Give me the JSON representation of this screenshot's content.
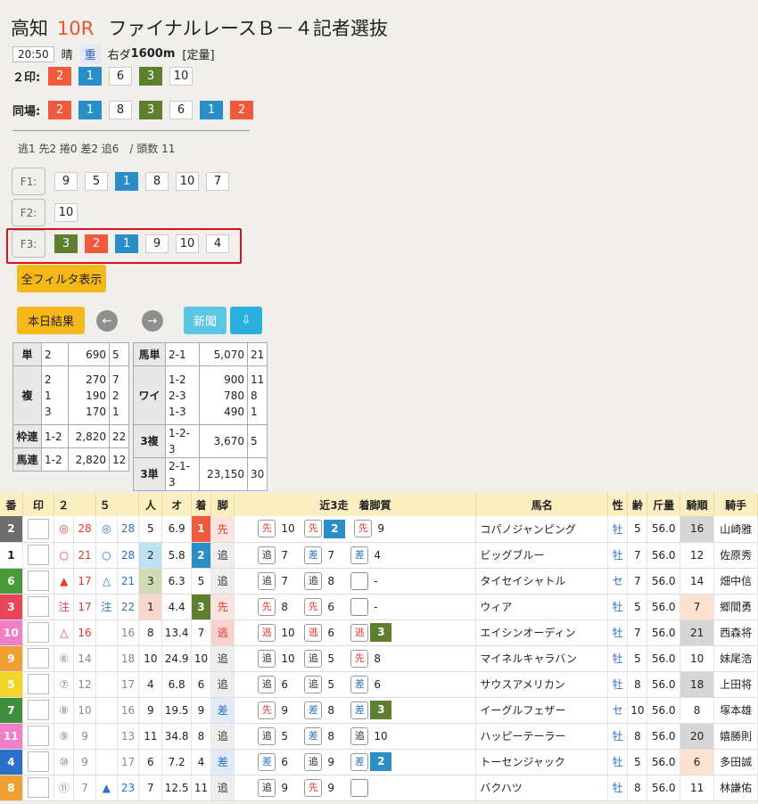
{
  "header": {
    "track": "高知",
    "race_no": "10R",
    "race_name": "ファイナルレースＢ－４記者選抜",
    "time": "20:50",
    "weather": "晴",
    "condition": "重",
    "course": "右ダ",
    "distance": "1600m",
    "rule": "[定量]"
  },
  "marks2": {
    "label": "２印:",
    "nums": [
      {
        "v": "2",
        "c": "c1"
      },
      {
        "v": "1",
        "c": "c2"
      },
      {
        "v": "6",
        "c": ""
      },
      {
        "v": "3",
        "c": "c3"
      },
      {
        "v": "10",
        "c": ""
      }
    ]
  },
  "same": {
    "label": "同場:",
    "nums": [
      {
        "v": "2",
        "c": "c1"
      },
      {
        "v": "1",
        "c": "c2"
      },
      {
        "v": "8",
        "c": ""
      },
      {
        "v": "3",
        "c": "c3"
      },
      {
        "v": "6",
        "c": ""
      },
      {
        "v": "1",
        "c": "c2"
      },
      {
        "v": "2",
        "c": "c1"
      }
    ]
  },
  "stats": "逃1 先2 捲0 差2 追6　/ 頭数 11",
  "filters": [
    {
      "label": "F1:",
      "nums": [
        {
          "v": "9",
          "c": ""
        },
        {
          "v": "5",
          "c": ""
        },
        {
          "v": "1",
          "c": "c2"
        },
        {
          "v": "8",
          "c": ""
        },
        {
          "v": "10",
          "c": ""
        },
        {
          "v": "7",
          "c": ""
        }
      ]
    },
    {
      "label": "F2:",
      "nums": [
        {
          "v": "10",
          "c": ""
        }
      ]
    },
    {
      "label": "F3:",
      "nums": [
        {
          "v": "3",
          "c": "c3"
        },
        {
          "v": "2",
          "c": "c1"
        },
        {
          "v": "1",
          "c": "c2"
        },
        {
          "v": "9",
          "c": ""
        },
        {
          "v": "10",
          "c": ""
        },
        {
          "v": "4",
          "c": ""
        }
      ]
    }
  ],
  "buttons": {
    "all_filters": "全フィルタ表示",
    "today_results": "本日結果",
    "prev": "←",
    "next": "→",
    "newspaper": "新聞",
    "download": "⇩"
  },
  "payout_left": {
    "tan": {
      "label": "単",
      "combo": "2",
      "amount": "690",
      "pop": "5"
    },
    "fuku": {
      "label": "複",
      "rows": [
        {
          "combo": "2",
          "amount": "270",
          "pop": "7"
        },
        {
          "combo": "1",
          "amount": "190",
          "pop": "2"
        },
        {
          "combo": "3",
          "amount": "170",
          "pop": "1"
        }
      ]
    },
    "wakuren": {
      "label": "枠連",
      "combo": "1-2",
      "amount": "2,820",
      "pop": "22"
    },
    "umaren": {
      "label": "馬連",
      "combo": "1-2",
      "amount": "2,820",
      "pop": "12"
    }
  },
  "payout_right": {
    "umatan": {
      "label": "馬単",
      "combo": "2-1",
      "amount": "5,070",
      "pop": "21"
    },
    "wide": {
      "label": "ワイ",
      "rows": [
        {
          "combo": "1-2",
          "amount": "900",
          "pop": "11"
        },
        {
          "combo": "2-3",
          "amount": "780",
          "pop": "8"
        },
        {
          "combo": "1-3",
          "amount": "490",
          "pop": "1"
        }
      ]
    },
    "sanfuku": {
      "label": "3複",
      "combo": "1-2-3",
      "amount": "3,670",
      "pop": "5"
    },
    "santan": {
      "label": "3単",
      "combo": "2-1-3",
      "amount": "23,150",
      "pop": "30"
    }
  },
  "table": {
    "headers": {
      "ban": "番",
      "in": "印",
      "two": "２",
      "five": "５",
      "pop": "人",
      "odds": "オ",
      "finish": "着",
      "leg": "脚",
      "recent": "近3走　着脚質",
      "name": "馬名",
      "sex": "性",
      "age": "齢",
      "weight": "斤量",
      "jrank": "騎順",
      "jockey": "騎手"
    },
    "rows": [
      {
        "ban": "2",
        "bc": "#6e6e6e",
        "m2": "◎",
        "m2c": "red",
        "v2": "28",
        "v2c": "red",
        "m5": "◎",
        "m5c": "blue",
        "v5": "28",
        "v5c": "blue",
        "pop": "5",
        "popbg": "",
        "odds": "6.9",
        "fin": "1",
        "finbg": "#ef5a3c",
        "leg": "先",
        "legbg": "#fbe3df",
        "legc": "#e03a2a",
        "r": [
          {
            "k": "先",
            "t": "s",
            "p": "10",
            "pb": ""
          },
          {
            "k": "先",
            "t": "s",
            "p": "2",
            "pb": "#2a8fc9"
          },
          {
            "k": "先",
            "t": "s",
            "p": "9",
            "pb": ""
          }
        ],
        "name": "コパノジャンピング",
        "sex": "牡",
        "age": "5",
        "wt": "56.0",
        "jr": "16",
        "jrbg": "#d6d6d6",
        "jockey": "山崎雅"
      },
      {
        "ban": "1",
        "bc": "#ffffff",
        "m2": "○",
        "m2c": "red",
        "v2": "21",
        "v2c": "red",
        "m5": "○",
        "m5c": "blue",
        "v5": "28",
        "v5c": "blue",
        "pop": "2",
        "popbg": "#bde2f2",
        "odds": "5.8",
        "fin": "2",
        "finbg": "#2a8fc9",
        "leg": "追",
        "legbg": "#eeeeee",
        "legc": "#333",
        "r": [
          {
            "k": "追",
            "t": "b",
            "p": "7",
            "pb": ""
          },
          {
            "k": "差",
            "t": "d",
            "p": "7",
            "pb": ""
          },
          {
            "k": "差",
            "t": "d",
            "p": "4",
            "pb": ""
          }
        ],
        "name": "ビッグブルー",
        "sex": "牡",
        "age": "7",
        "wt": "56.0",
        "jr": "12",
        "jrbg": "",
        "jockey": "佐原秀"
      },
      {
        "ban": "6",
        "bc": "#4a9a3a",
        "m2": "▲",
        "m2c": "red",
        "v2": "17",
        "v2c": "red",
        "m5": "△",
        "m5c": "blue",
        "v5": "21",
        "v5c": "blue",
        "pop": "3",
        "popbg": "#cfdcb3",
        "odds": "6.3",
        "fin": "5",
        "finbg": "",
        "leg": "追",
        "legbg": "#eeeeee",
        "legc": "#333",
        "r": [
          {
            "k": "追",
            "t": "b",
            "p": "7",
            "pb": ""
          },
          {
            "k": "追",
            "t": "b",
            "p": "8",
            "pb": ""
          },
          {
            "k": "",
            "t": "n",
            "p": "-",
            "pb": ""
          }
        ],
        "name": "タイセイシャトル",
        "sex": "セ",
        "age": "7",
        "wt": "56.0",
        "jr": "14",
        "jrbg": "",
        "jockey": "畑中信"
      },
      {
        "ban": "3",
        "bc": "#e8455a",
        "m2": "注",
        "m2c": "red",
        "v2": "17",
        "v2c": "red",
        "m5": "注",
        "m5c": "blue",
        "v5": "22",
        "v5c": "blue",
        "pop": "1",
        "popbg": "#f9d6cc",
        "odds": "4.4",
        "fin": "3",
        "finbg": "#5e7f30",
        "leg": "先",
        "legbg": "#fbe3df",
        "legc": "#e03a2a",
        "r": [
          {
            "k": "先",
            "t": "s",
            "p": "8",
            "pb": ""
          },
          {
            "k": "先",
            "t": "s",
            "p": "6",
            "pb": ""
          },
          {
            "k": "",
            "t": "n",
            "p": "-",
            "pb": ""
          }
        ],
        "name": "ウィア",
        "sex": "牡",
        "age": "5",
        "wt": "56.0",
        "jr": "7",
        "jrbg": "#fde2d2",
        "jockey": "郷間勇"
      },
      {
        "ban": "10",
        "bc": "#f07fc8",
        "m2": "△",
        "m2c": "red",
        "v2": "16",
        "v2c": "red",
        "m5": "",
        "m5c": "",
        "v5": "16",
        "v5c": "gray",
        "pop": "8",
        "popbg": "",
        "odds": "13.4",
        "fin": "7",
        "finbg": "",
        "leg": "逃",
        "legbg": "#f9d2cf",
        "legc": "#e03a2a",
        "r": [
          {
            "k": "逃",
            "t": "s",
            "p": "10",
            "pb": ""
          },
          {
            "k": "逃",
            "t": "s",
            "p": "6",
            "pb": ""
          },
          {
            "k": "逃",
            "t": "s",
            "p": "3",
            "pb": "#5e7f30"
          }
        ],
        "name": "エイシンオーディン",
        "sex": "牡",
        "age": "7",
        "wt": "56.0",
        "jr": "21",
        "jrbg": "#d6d6d6",
        "jockey": "西森将"
      },
      {
        "ban": "9",
        "bc": "#f0a033",
        "m2": "⑥",
        "m2c": "gray",
        "v2": "14",
        "v2c": "gray",
        "m5": "",
        "m5c": "",
        "v5": "18",
        "v5c": "gray",
        "pop": "10",
        "popbg": "",
        "odds": "24.9",
        "fin": "10",
        "finbg": "",
        "leg": "追",
        "legbg": "#eeeeee",
        "legc": "#333",
        "r": [
          {
            "k": "追",
            "t": "b",
            "p": "10",
            "pb": ""
          },
          {
            "k": "追",
            "t": "b",
            "p": "5",
            "pb": ""
          },
          {
            "k": "先",
            "t": "s",
            "p": "8",
            "pb": ""
          }
        ],
        "name": "マイネルキャラバン",
        "sex": "牡",
        "age": "5",
        "wt": "56.0",
        "jr": "10",
        "jrbg": "",
        "jockey": "妹尾浩"
      },
      {
        "ban": "5",
        "bc": "#f3d52a",
        "m2": "⑦",
        "m2c": "gray",
        "v2": "12",
        "v2c": "gray",
        "m5": "",
        "m5c": "",
        "v5": "17",
        "v5c": "gray",
        "pop": "4",
        "popbg": "",
        "odds": "6.8",
        "fin": "6",
        "finbg": "",
        "leg": "追",
        "legbg": "#eeeeee",
        "legc": "#333",
        "r": [
          {
            "k": "追",
            "t": "b",
            "p": "6",
            "pb": ""
          },
          {
            "k": "追",
            "t": "b",
            "p": "5",
            "pb": ""
          },
          {
            "k": "差",
            "t": "d",
            "p": "6",
            "pb": ""
          }
        ],
        "name": "サウスアメリカン",
        "sex": "牡",
        "age": "8",
        "wt": "56.0",
        "jr": "18",
        "jrbg": "#d6d6d6",
        "jockey": "上田将"
      },
      {
        "ban": "7",
        "bc": "#3f8f3f",
        "m2": "⑧",
        "m2c": "gray",
        "v2": "10",
        "v2c": "gray",
        "m5": "",
        "m5c": "",
        "v5": "16",
        "v5c": "gray",
        "pop": "9",
        "popbg": "",
        "odds": "19.5",
        "fin": "9",
        "finbg": "",
        "leg": "差",
        "legbg": "#e1ebf8",
        "legc": "#2a72c9",
        "r": [
          {
            "k": "先",
            "t": "s",
            "p": "9",
            "pb": ""
          },
          {
            "k": "差",
            "t": "d",
            "p": "8",
            "pb": ""
          },
          {
            "k": "差",
            "t": "d",
            "p": "3",
            "pb": "#5e7f30"
          }
        ],
        "name": "イーグルフェザー",
        "sex": "セ",
        "age": "10",
        "wt": "56.0",
        "jr": "8",
        "jrbg": "",
        "jockey": "塚本雄"
      },
      {
        "ban": "11",
        "bc": "#f07fc8",
        "m2": "⑨",
        "m2c": "gray",
        "v2": "9",
        "v2c": "gray",
        "m5": "",
        "m5c": "",
        "v5": "13",
        "v5c": "gray",
        "pop": "11",
        "popbg": "",
        "odds": "34.8",
        "fin": "8",
        "finbg": "",
        "leg": "追",
        "legbg": "#eeeeee",
        "legc": "#333",
        "r": [
          {
            "k": "追",
            "t": "b",
            "p": "5",
            "pb": ""
          },
          {
            "k": "差",
            "t": "d",
            "p": "8",
            "pb": ""
          },
          {
            "k": "追",
            "t": "b",
            "p": "10",
            "pb": ""
          }
        ],
        "name": "ハッピーテーラー",
        "sex": "牡",
        "age": "8",
        "wt": "56.0",
        "jr": "20",
        "jrbg": "#d6d6d6",
        "jockey": "嬉勝則"
      },
      {
        "ban": "4",
        "bc": "#2a6fc9",
        "m2": "⑩",
        "m2c": "gray",
        "v2": "9",
        "v2c": "gray",
        "m5": "",
        "m5c": "",
        "v5": "17",
        "v5c": "gray",
        "pop": "6",
        "popbg": "",
        "odds": "7.2",
        "fin": "4",
        "finbg": "",
        "leg": "差",
        "legbg": "#e1ebf8",
        "legc": "#2a72c9",
        "r": [
          {
            "k": "差",
            "t": "d",
            "p": "6",
            "pb": ""
          },
          {
            "k": "追",
            "t": "b",
            "p": "9",
            "pb": ""
          },
          {
            "k": "差",
            "t": "d",
            "p": "2",
            "pb": "#2a8fc9"
          }
        ],
        "name": "トーセンジャック",
        "sex": "牡",
        "age": "5",
        "wt": "56.0",
        "jr": "6",
        "jrbg": "#fde2d2",
        "jockey": "多田誠"
      },
      {
        "ban": "8",
        "bc": "#f0a033",
        "m2": "⑪",
        "m2c": "gray",
        "v2": "7",
        "v2c": "gray",
        "m5": "▲",
        "m5c": "blue",
        "v5": "23",
        "v5c": "blue",
        "pop": "7",
        "popbg": "",
        "odds": "12.5",
        "fin": "11",
        "finbg": "",
        "leg": "追",
        "legbg": "#eeeeee",
        "legc": "#333",
        "r": [
          {
            "k": "追",
            "t": "b",
            "p": "9",
            "pb": ""
          },
          {
            "k": "先",
            "t": "s",
            "p": "9",
            "pb": ""
          },
          {
            "k": "",
            "t": "n",
            "p": "",
            "pb": ""
          }
        ],
        "name": "バクハツ",
        "sex": "牡",
        "age": "8",
        "wt": "56.0",
        "jr": "11",
        "jrbg": "",
        "jockey": "林謙佑"
      }
    ]
  }
}
